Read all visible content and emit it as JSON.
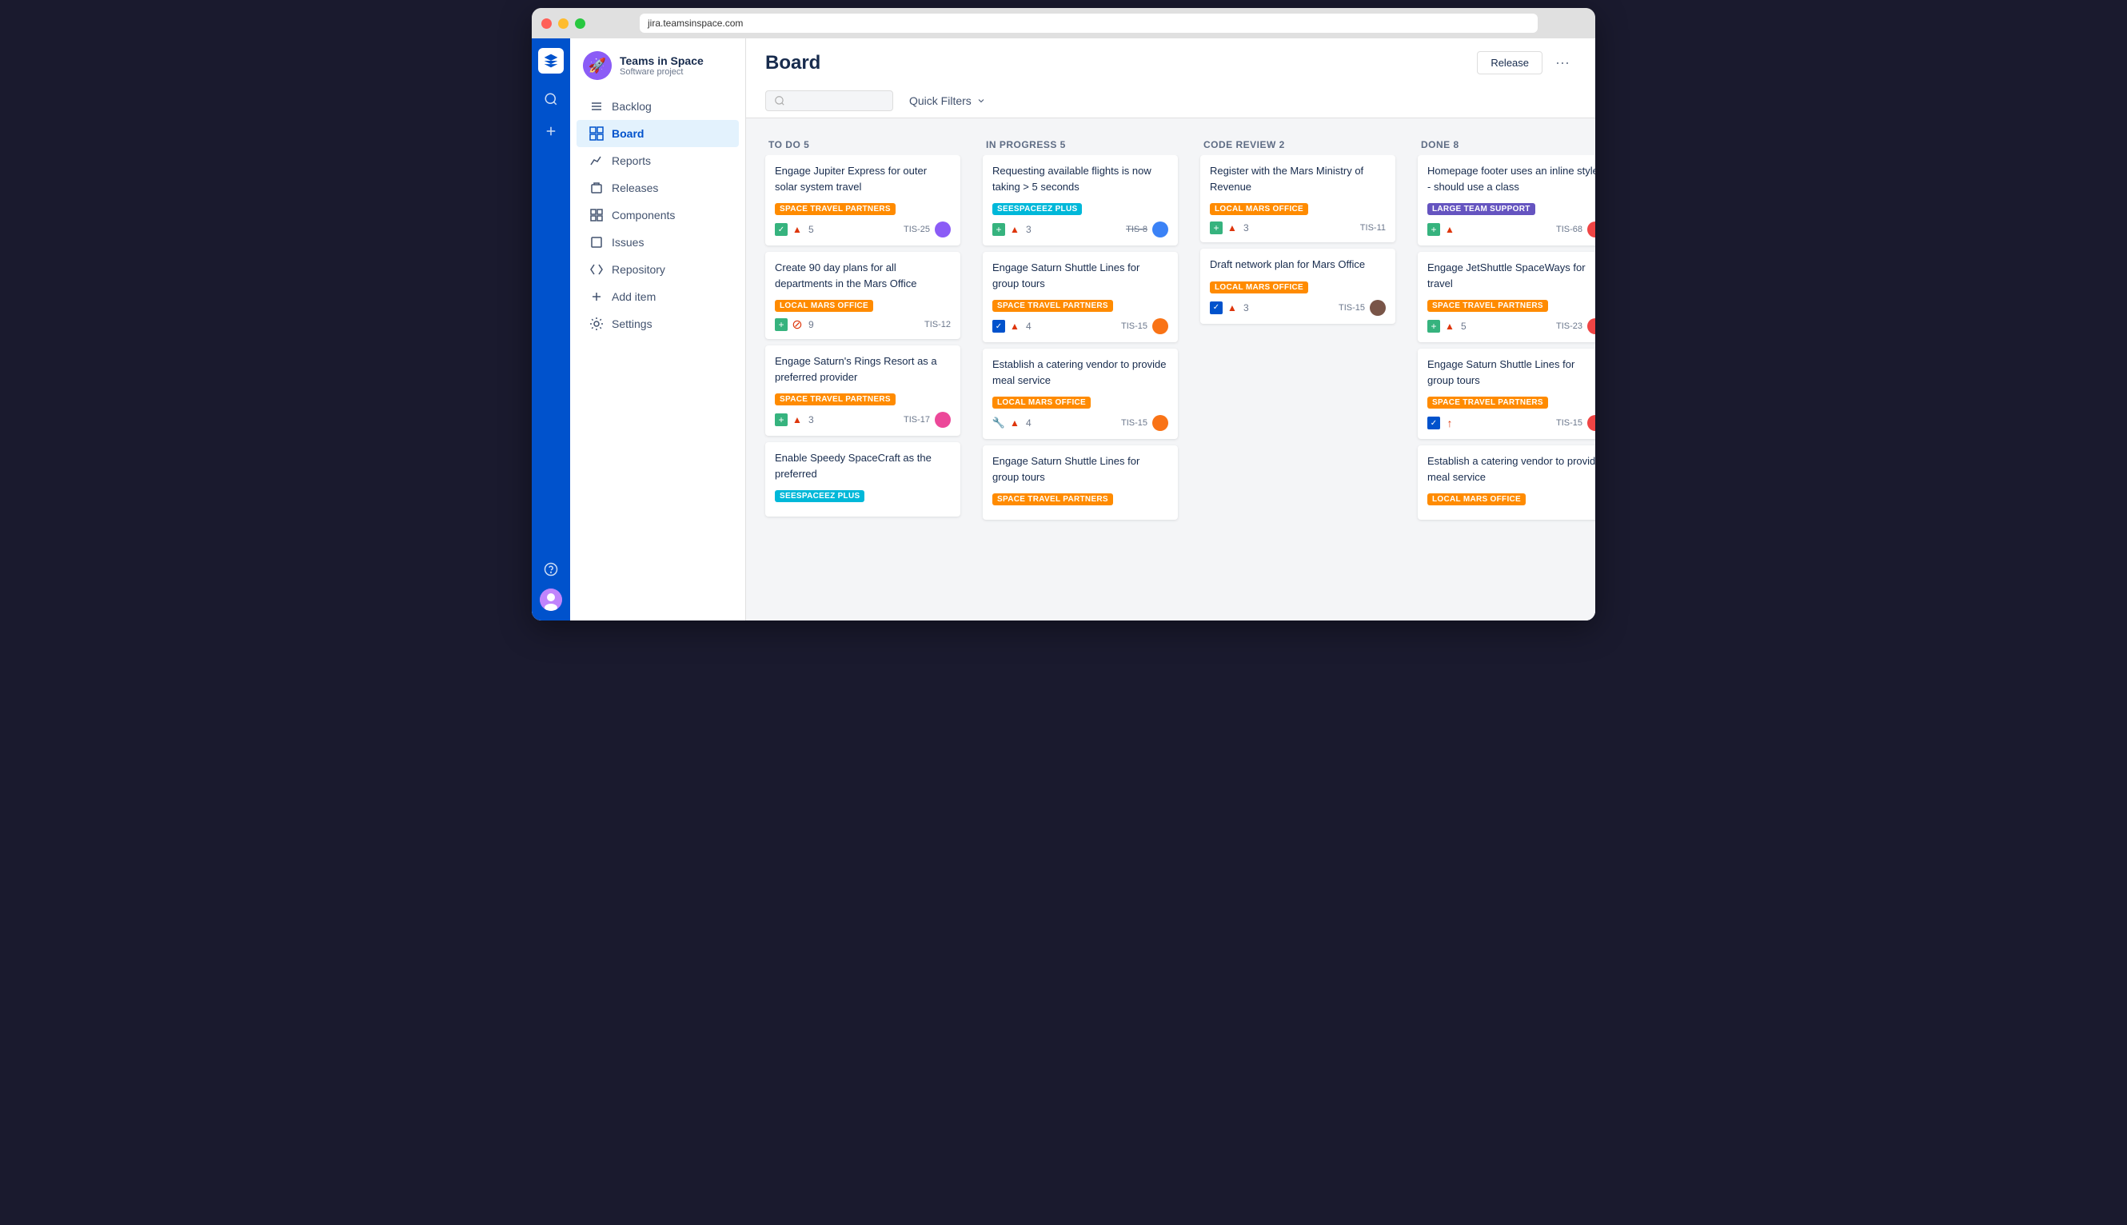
{
  "browser": {
    "url": "jira.teamsinspace.com"
  },
  "project": {
    "name": "Teams in Space",
    "type": "Software project",
    "avatar_emoji": "🚀"
  },
  "nav_icons": [
    "search",
    "plus",
    "help",
    "user"
  ],
  "sidebar": {
    "items": [
      {
        "id": "backlog",
        "label": "Backlog",
        "icon": "☰"
      },
      {
        "id": "board",
        "label": "Board",
        "icon": "⊞",
        "active": true
      },
      {
        "id": "reports",
        "label": "Reports",
        "icon": "📈"
      },
      {
        "id": "releases",
        "label": "Releases",
        "icon": "📦"
      },
      {
        "id": "components",
        "label": "Components",
        "icon": "📋"
      },
      {
        "id": "issues",
        "label": "Issues",
        "icon": "🔲"
      },
      {
        "id": "repository",
        "label": "Repository",
        "icon": "⟨⟩"
      },
      {
        "id": "add-item",
        "label": "Add item",
        "icon": "+"
      },
      {
        "id": "settings",
        "label": "Settings",
        "icon": "⚙"
      }
    ]
  },
  "header": {
    "title": "Board",
    "release_label": "Release",
    "more_label": "···",
    "search_placeholder": "",
    "quick_filters_label": "Quick Filters"
  },
  "columns": [
    {
      "id": "todo",
      "title": "TO DO",
      "count": 5,
      "cards": [
        {
          "title": "Engage Jupiter Express for outer solar system travel",
          "tag": "SPACE TRAVEL PARTNERS",
          "tag_color": "orange",
          "icons": [
            "check-green",
            "arrow-red"
          ],
          "count": "5",
          "id": "TIS-25",
          "avatar_color": "purple"
        },
        {
          "title": "Create 90 day plans for all departments in the Mars Office",
          "tag": "LOCAL MARS OFFICE",
          "tag_color": "orange",
          "icons": [
            "plus-green",
            "blocked"
          ],
          "count": "9",
          "id": "TIS-12",
          "avatar_color": null
        },
        {
          "title": "Engage Saturn's Rings Resort as a preferred provider",
          "tag": "SPACE TRAVEL PARTNERS",
          "tag_color": "orange",
          "icons": [
            "plus-green",
            "arrow-red"
          ],
          "count": "3",
          "id": "TIS-17",
          "avatar_color": "pink"
        },
        {
          "title": "Enable Speedy SpaceCraft as the preferred",
          "tag": "SEESPACEEZ PLUS",
          "tag_color": "teal",
          "icons": [],
          "count": "",
          "id": "",
          "avatar_color": null
        }
      ]
    },
    {
      "id": "inprogress",
      "title": "IN PROGRESS",
      "count": 5,
      "cards": [
        {
          "title": "Requesting available flights is now taking > 5 seconds",
          "tag": "SEESPACEEZ PLUS",
          "tag_color": "teal",
          "icons": [
            "plus-green",
            "arrow-red"
          ],
          "count": "3",
          "id": "TIS-8",
          "avatar_color": "blue",
          "id_strikethrough": true
        },
        {
          "title": "Engage Saturn Shuttle Lines for group tours",
          "tag": "SPACE TRAVEL PARTNERS",
          "tag_color": "orange",
          "icons": [
            "check-blue",
            "arrow-red"
          ],
          "count": "4",
          "id": "TIS-15",
          "avatar_color": "orange"
        },
        {
          "title": "Establish a catering vendor to provide meal service",
          "tag": "LOCAL MARS OFFICE",
          "tag_color": "orange",
          "icons": [
            "wrench",
            "arrow-red"
          ],
          "count": "4",
          "id": "TIS-15",
          "avatar_color": "orange"
        },
        {
          "title": "Engage Saturn Shuttle Lines for group tours",
          "tag": "SPACE TRAVEL PARTNERS",
          "tag_color": "orange",
          "icons": [],
          "count": "",
          "id": "",
          "avatar_color": null
        }
      ]
    },
    {
      "id": "codereview",
      "title": "CODE REVIEW",
      "count": 2,
      "cards": [
        {
          "title": "Register with the Mars Ministry of Revenue",
          "tag": "LOCAL MARS OFFICE",
          "tag_color": "orange",
          "icons": [
            "plus-green",
            "arrow-red"
          ],
          "count": "3",
          "id": "TIS-11",
          "avatar_color": null
        },
        {
          "title": "Draft network plan for Mars Office",
          "tag": "LOCAL MARS OFFICE",
          "tag_color": "orange",
          "icons": [
            "check-blue",
            "arrow-red"
          ],
          "count": "3",
          "id": "TIS-15",
          "avatar_color": "brown"
        }
      ]
    },
    {
      "id": "done",
      "title": "DONE",
      "count": 8,
      "cards": [
        {
          "title": "Homepage footer uses an inline style - should use a class",
          "tag": "LARGE TEAM SUPPORT",
          "tag_color": "purple",
          "icons": [
            "plus-green",
            "arrow-red"
          ],
          "count": "",
          "id": "TIS-68",
          "avatar_color": "red"
        },
        {
          "title": "Engage JetShuttle SpaceWays for travel",
          "tag": "SPACE TRAVEL PARTNERS",
          "tag_color": "orange",
          "icons": [
            "plus-green",
            "arrow-red"
          ],
          "count": "5",
          "id": "TIS-23",
          "avatar_color": "red"
        },
        {
          "title": "Engage Saturn Shuttle Lines for group tours",
          "tag": "SPACE TRAVEL PARTNERS",
          "tag_color": "orange",
          "icons": [
            "check-blue",
            "arrow-red-up"
          ],
          "count": "",
          "id": "TIS-15",
          "avatar_color": "red"
        },
        {
          "title": "Establish a catering vendor to provide meal service",
          "tag": "LOCAL MARS OFFICE",
          "tag_color": "orange",
          "icons": [],
          "count": "",
          "id": "",
          "avatar_color": null
        }
      ]
    }
  ]
}
